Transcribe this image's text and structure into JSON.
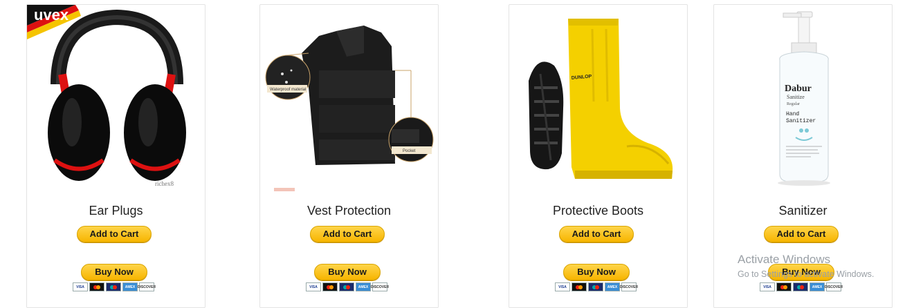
{
  "products": [
    {
      "name": "Ear Plugs",
      "brand_text": "uvex",
      "image_caption": "richex8",
      "add_to_cart": "Add to Cart",
      "buy_now": "Buy Now"
    },
    {
      "name": "Vest Protection",
      "callout_left": "Waterproof material",
      "callout_right": "Pocket",
      "add_to_cart": "Add to Cart",
      "buy_now": "Buy Now"
    },
    {
      "name": "Protective Boots",
      "brand_text": "DUNLOP",
      "add_to_cart": "Add to Cart",
      "buy_now": "Buy Now"
    },
    {
      "name": "Sanitizer",
      "bottle_brand": "Dabur",
      "bottle_line1": "Sanitize",
      "bottle_line2": "Regular",
      "bottle_line3": "Hand",
      "bottle_line4": "Sanitizer",
      "add_to_cart": "Add to Cart",
      "buy_now": "Buy Now"
    }
  ],
  "payment_methods": [
    "VISA",
    "mastercard",
    "maestro",
    "AMEX",
    "DISCOVER"
  ],
  "watermark": {
    "title": "Activate Windows",
    "subtitle": "Go to Settings to activate Windows."
  },
  "colors": {
    "button_top": "#ffd54a",
    "button_bottom": "#f7b500",
    "boot_yellow": "#f4d000"
  }
}
